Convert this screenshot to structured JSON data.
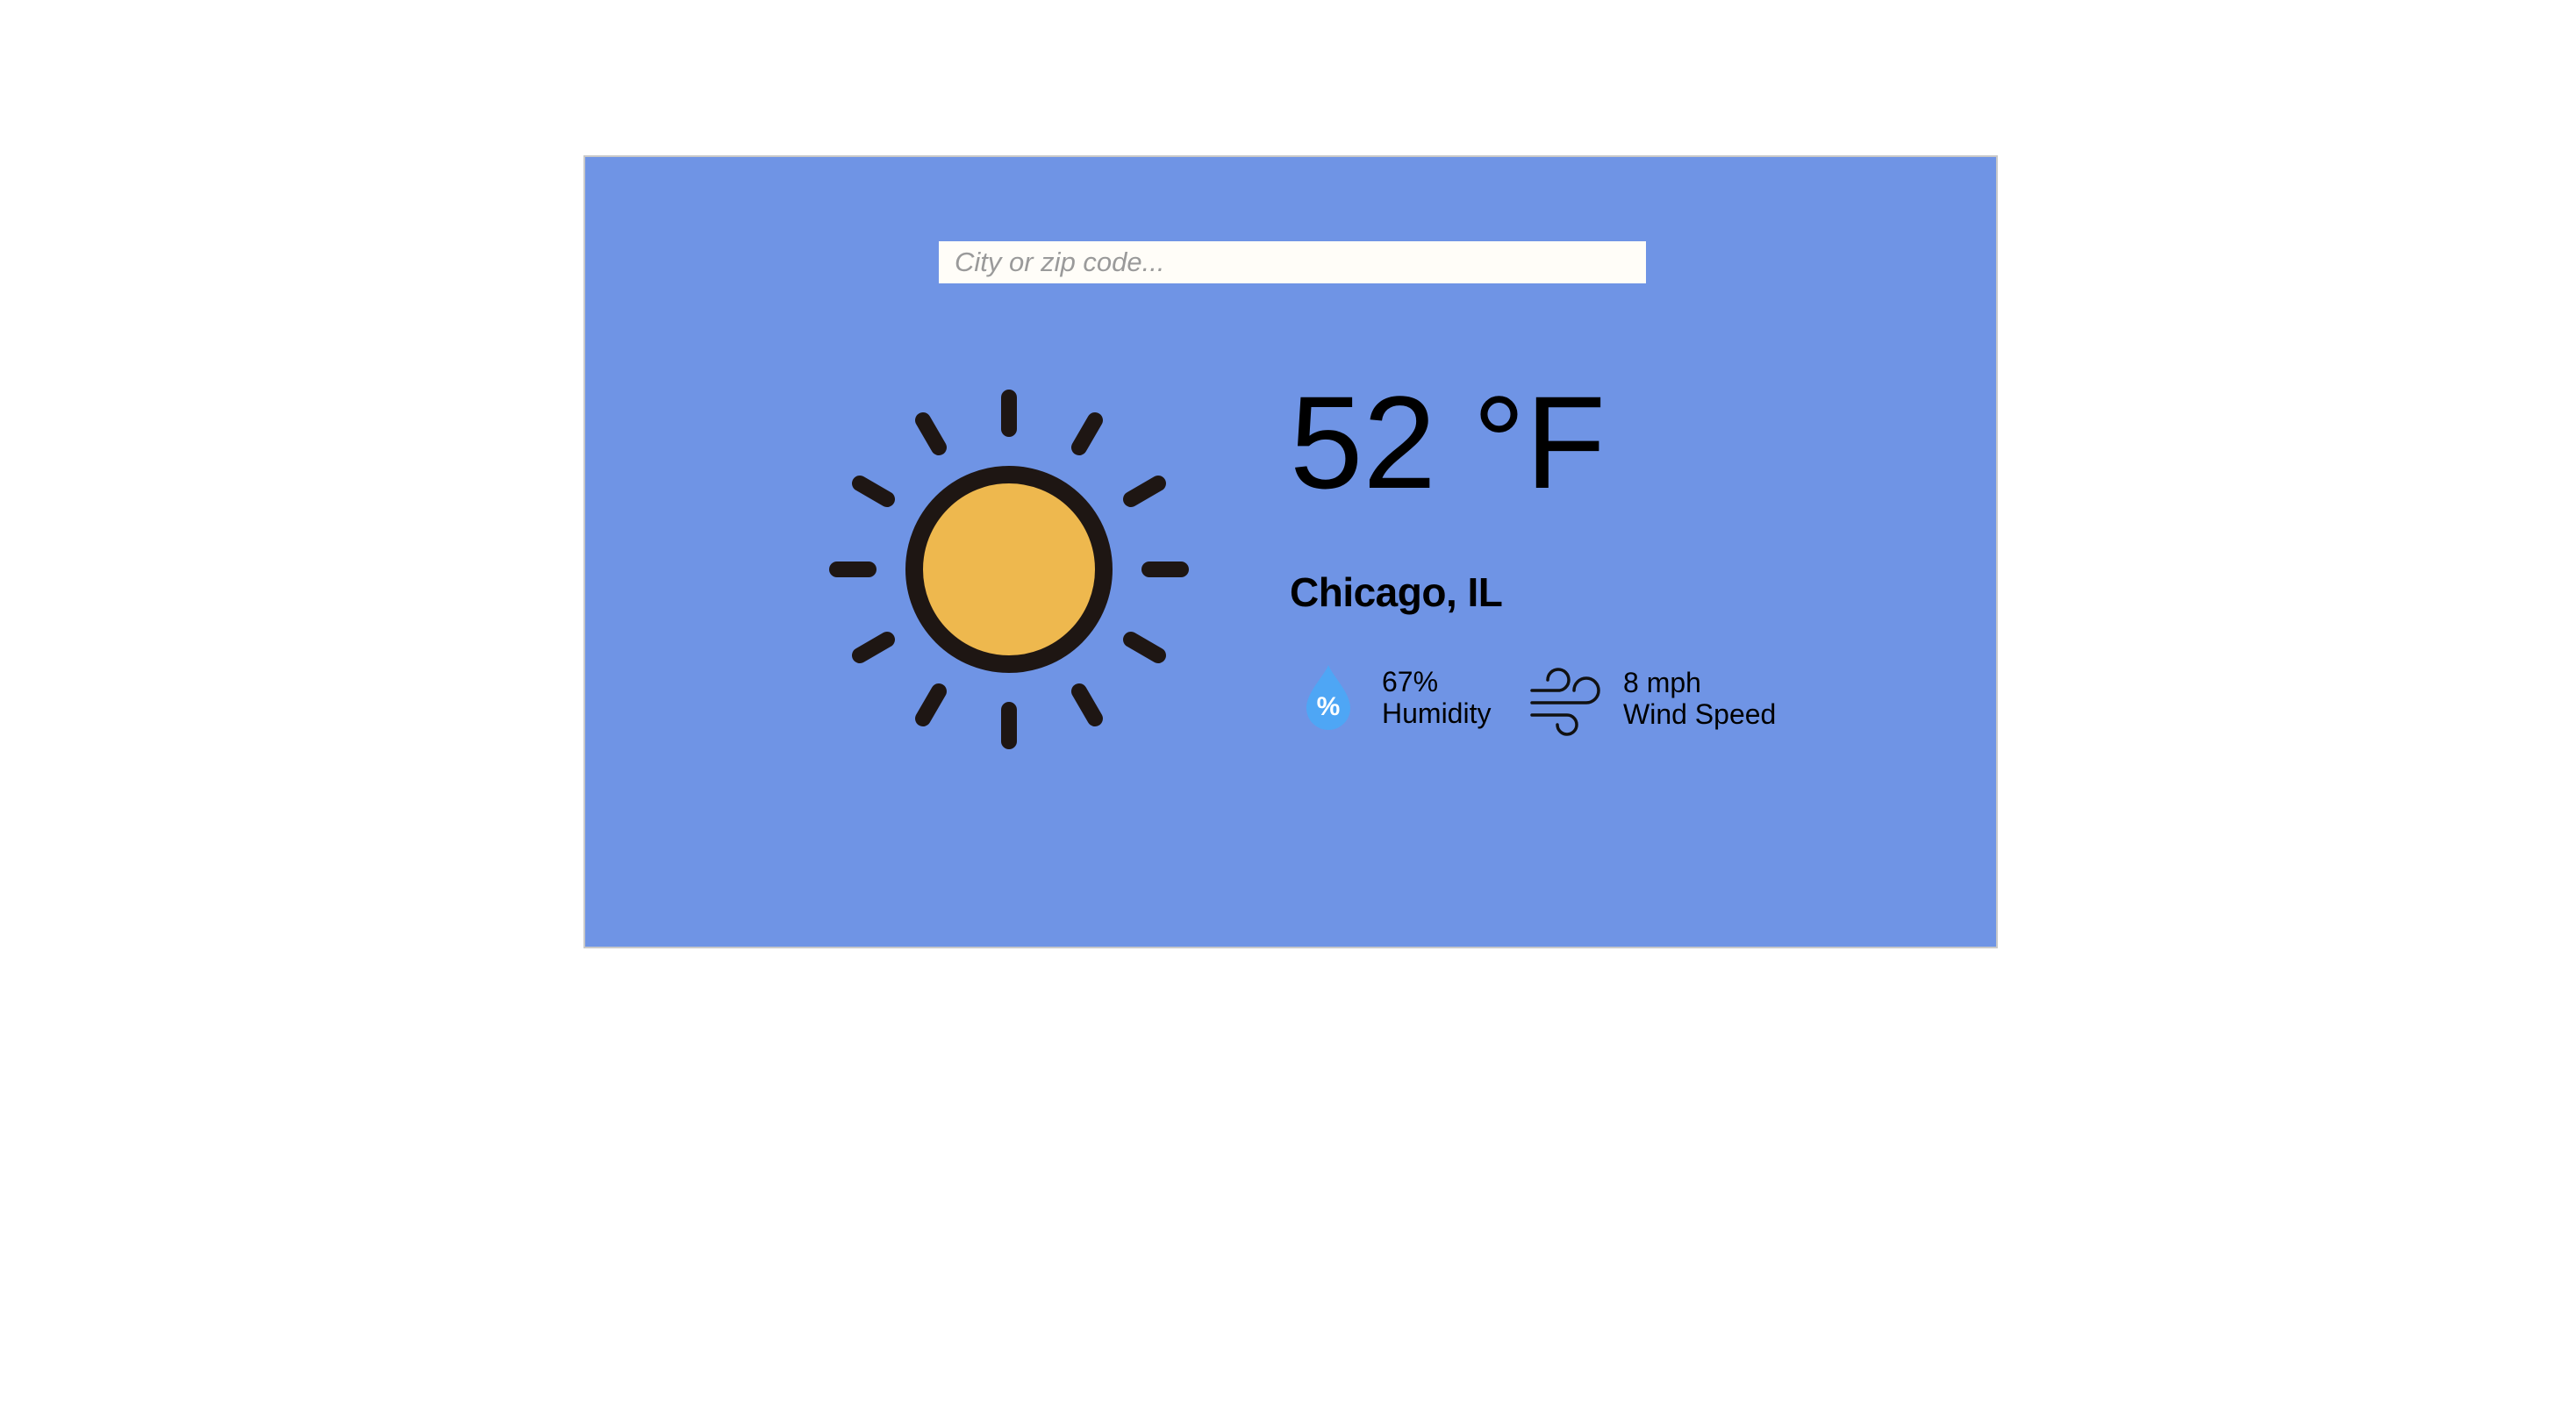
{
  "search": {
    "placeholder": "City or zip code...",
    "value": ""
  },
  "weather": {
    "condition_icon": "sun-icon",
    "temperature": "52 °F",
    "location": "Chicago, IL"
  },
  "stats": {
    "humidity": {
      "icon": "humidity-drop-icon",
      "icon_glyph": "%",
      "value": "67%",
      "label": "Humidity"
    },
    "wind": {
      "icon": "wind-icon",
      "value": "8 mph",
      "label": "Wind Speed"
    }
  },
  "colors": {
    "card_background": "#6f94e5",
    "sun_fill": "#eeb84e",
    "sun_outline": "#1e1613",
    "drop_fill": "#4ea6f5"
  }
}
